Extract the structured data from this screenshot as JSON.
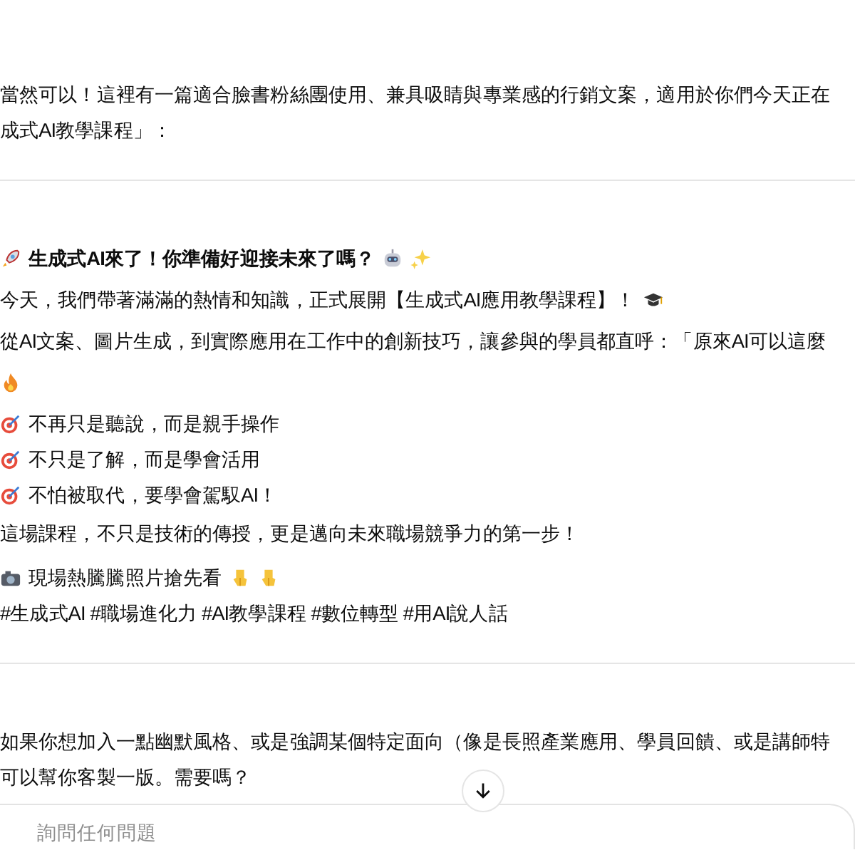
{
  "intro": [
    "當然可以！這裡有一篇適合臉書粉絲團使用、兼具吸睛與專業感的行銷文案，適用於你們今天正在",
    "成式AI教學課程」："
  ],
  "post": [
    {
      "kind": "heading",
      "text": "生成式AI來了！你準備好迎接未來了嗎？"
    },
    {
      "kind": "announce",
      "text": "今天，我們帶著滿滿的熱情和知識，正式展開【生成式AI應用教學課程】！"
    },
    {
      "kind": "paragraph",
      "text": "從AI文案、圖片生成，到實際應用在工作中的創新技巧，讓參與的學員都直呼：「原來AI可以這麼"
    },
    {
      "kind": "reaction"
    },
    {
      "kind": "bullet",
      "text": "不再只是聽說，而是親手操作"
    },
    {
      "kind": "bullet",
      "text": "不只是了解，而是學會活用"
    },
    {
      "kind": "bullet",
      "text": "不怕被取代，要學會駕馭AI！"
    },
    {
      "kind": "paragraph",
      "text": "這場課程，不只是技術的傳授，更是邁向未來職場競爭力的第一步！"
    },
    {
      "kind": "photos",
      "text": "現場熱騰騰照片搶先看"
    },
    {
      "kind": "tags",
      "text": "#生成式AI #職場進化力 #AI教學課程 #數位轉型 #用AI說人話"
    }
  ],
  "followup": [
    "如果你想加入一點幽默風格、或是強調某個特定面向（像是長照產業應用、學員回饋、或是講師特",
    "可以幫你客製一版。需要嗎？"
  ],
  "composer": {
    "placeholder": "詢問任何問題"
  }
}
